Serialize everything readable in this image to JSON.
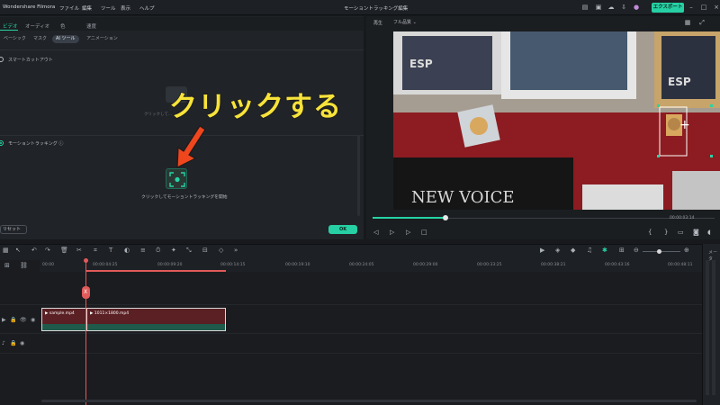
{
  "titlebar": {
    "app_name": "Wondershare Filmora",
    "menu": [
      "ファイル",
      "編集",
      "ツール",
      "表示",
      "ヘルプ"
    ],
    "window_title": "モーショントラッキング編集",
    "export_label": "エクスポート ⌄"
  },
  "left_panel": {
    "tabs": [
      "ビデオ",
      "オーディオ",
      "色",
      "速度"
    ],
    "subtabs": [
      "ベーシック",
      "マスク",
      "AI ツール",
      "アニメーション"
    ],
    "smart_cutout_label": "スマートカットアウト",
    "placeholder_hint": "クリックして...",
    "motion_tracking_label": "モーショントラッキング ⓘ",
    "mt_hint": "クリックしてモーショントラッキングを開始",
    "reset_label": "リセット",
    "ok_label": "OK",
    "annotation_text": "クリックする"
  },
  "preview": {
    "label": "再生",
    "quality": "フル品質 ⌄",
    "time_readout": "00:00:03:14",
    "tracker_symbol": "+"
  },
  "timeline": {
    "ticks": [
      "00:00",
      "00:00:04:25",
      "00:00:09:20",
      "00:00:14:15",
      "00:00:19:10",
      "00:00:24:05",
      "00:00:29:00",
      "00:00:33:25",
      "00:00:38:21",
      "00:00:43:16",
      "00:00:48:11"
    ],
    "clip1_label": "▶ sample.mp4",
    "clip2_label": "▶ 1011×1800.mp4",
    "playhead_symbol": "X",
    "right_strip_label": "メータ"
  },
  "colors": {
    "accent": "#27d3a5",
    "annotation": "#f7e33a",
    "playhead": "#e15a5a"
  }
}
